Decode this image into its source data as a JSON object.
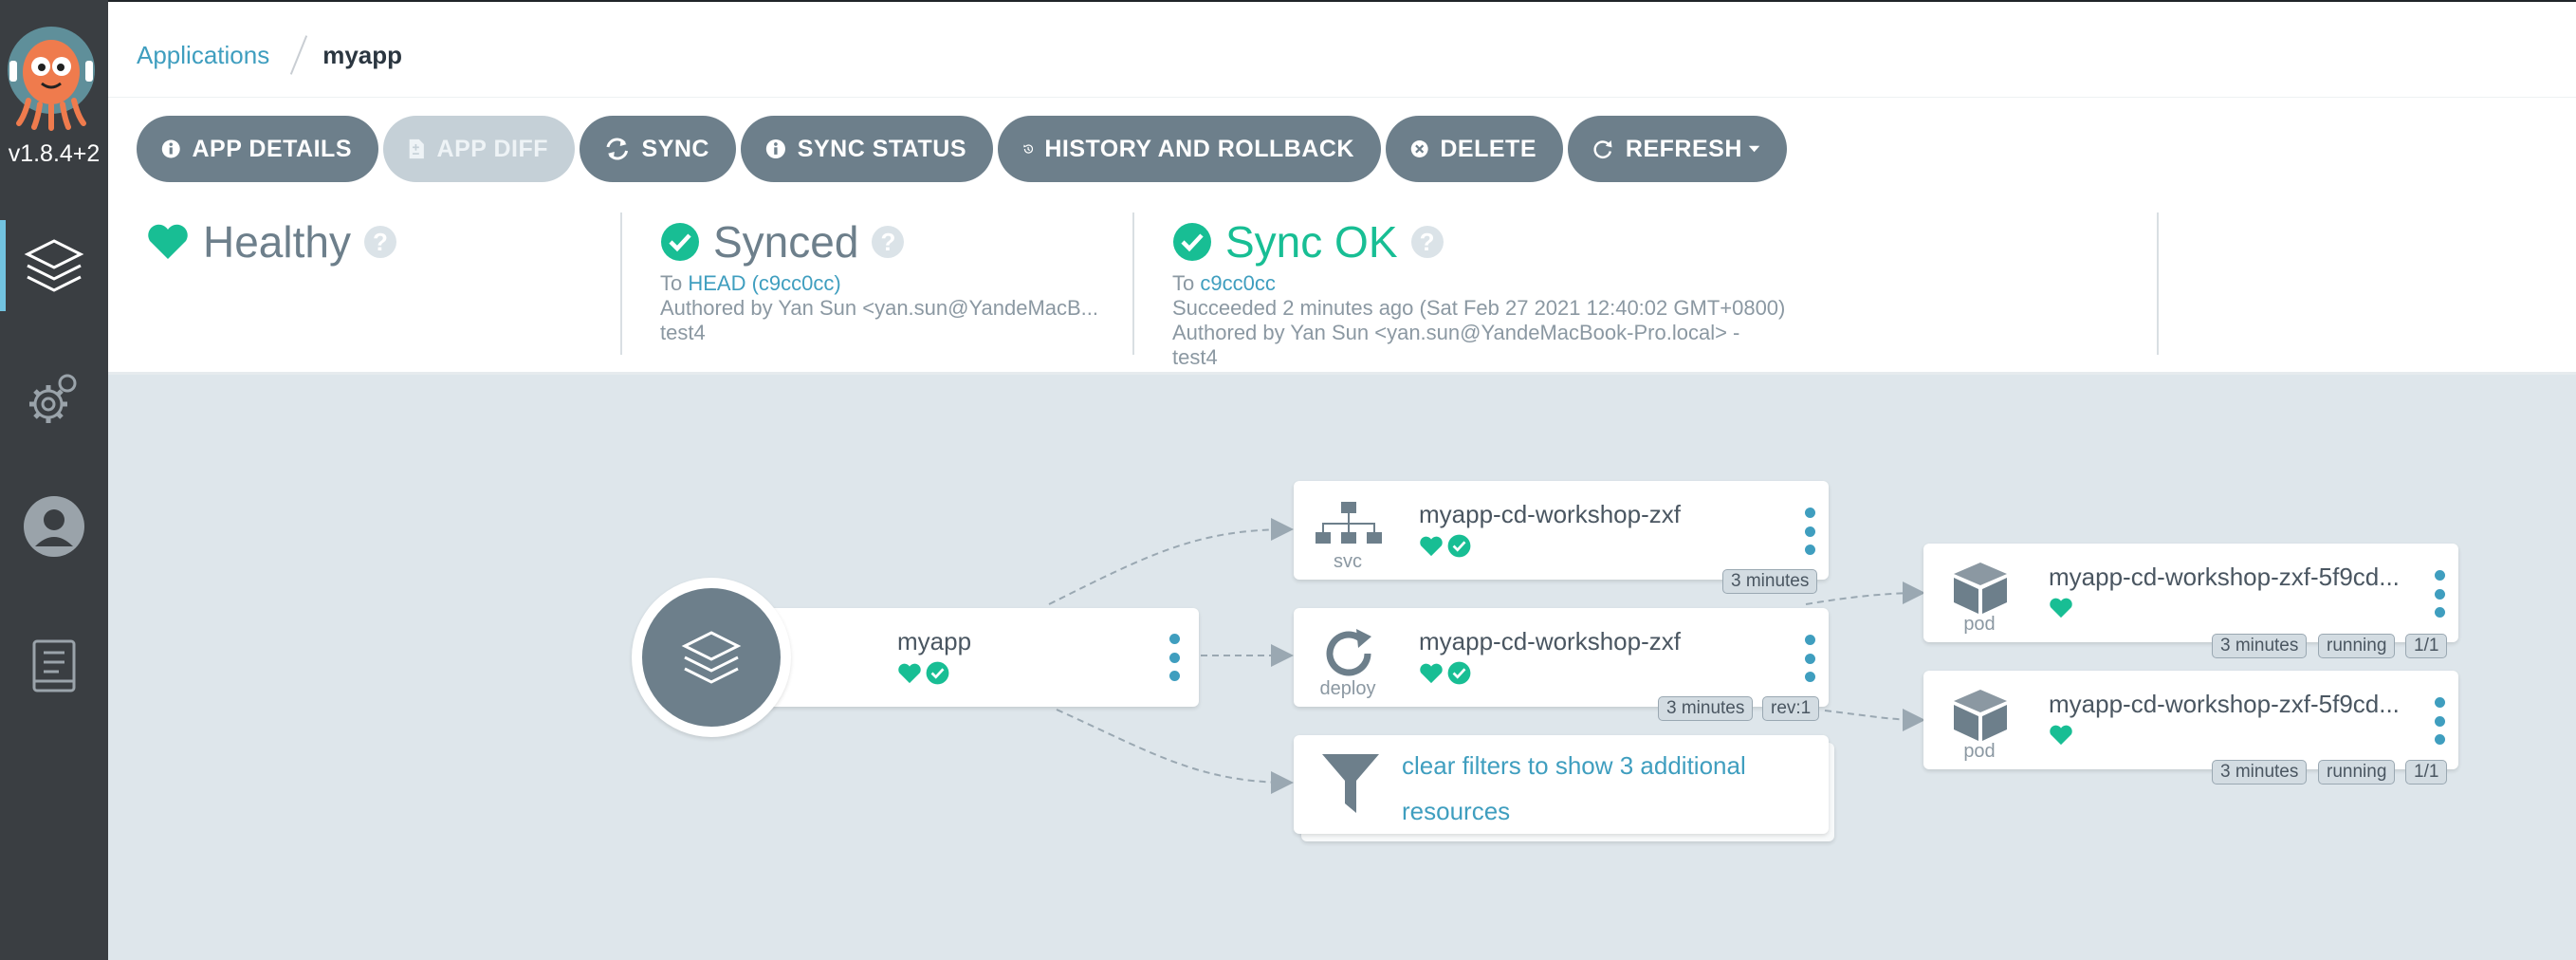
{
  "sidebar": {
    "version": "v1.8.4+2",
    "nav": [
      {
        "icon": "applications-icon"
      },
      {
        "icon": "settings-icon"
      },
      {
        "icon": "user-icon"
      },
      {
        "icon": "docs-icon"
      }
    ]
  },
  "breadcrumb": {
    "parent": "Applications",
    "current": "myapp"
  },
  "toolbar": {
    "app_details": "APP DETAILS",
    "app_diff": "APP DIFF",
    "sync": "SYNC",
    "sync_status": "SYNC STATUS",
    "history": "HISTORY AND ROLLBACK",
    "delete": "DELETE",
    "refresh": "REFRESH"
  },
  "status": {
    "health": {
      "title": "Healthy"
    },
    "sync": {
      "title": "Synced",
      "to_prefix": "To",
      "revision": "HEAD (c9cc0cc)",
      "author": "Authored by Yan Sun <yan.sun@YandeMacB...",
      "message": "test4"
    },
    "operation": {
      "title": "Sync OK",
      "to_prefix": "To",
      "revision": "c9cc0cc",
      "succeeded": "Succeeded 2 minutes ago (Sat Feb 27 2021 12:40:02 GMT+0800)",
      "author": "Authored by Yan Sun <yan.sun@YandeMacBook-Pro.local> -",
      "message": "test4"
    }
  },
  "graph": {
    "app": {
      "name": "myapp"
    },
    "svc": {
      "name": "myapp-cd-workshop-zxf",
      "kind": "svc",
      "age": "3 minutes"
    },
    "deploy": {
      "name": "myapp-cd-workshop-zxf",
      "kind": "deploy",
      "age": "3 minutes",
      "rev": "rev:1"
    },
    "filter": {
      "text": "clear filters to show 3 additional resources"
    },
    "pods": [
      {
        "name": "myapp-cd-workshop-zxf-5f9cd...",
        "kind": "pod",
        "age": "3 minutes",
        "state": "running",
        "ready": "1/1"
      },
      {
        "name": "myapp-cd-workshop-zxf-5f9cd...",
        "kind": "pod",
        "age": "3 minutes",
        "state": "running",
        "ready": "1/1"
      }
    ]
  },
  "colors": {
    "healthy": "#18be94",
    "link": "#3f9ebf",
    "sidebar": "#3a3e42",
    "button": "#6d7f8b"
  }
}
